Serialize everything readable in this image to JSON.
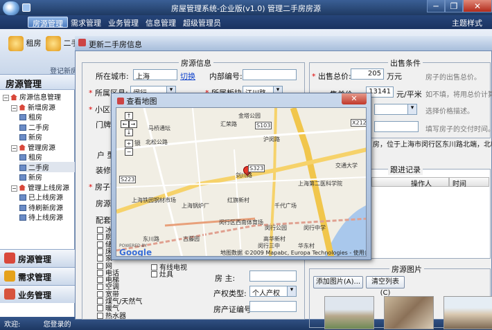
{
  "window": {
    "title": "房屋管理系统-企业版(v1.0) 管理二手房房源",
    "minimize": "─",
    "restore": "❐",
    "close": "✕"
  },
  "menu": {
    "items": [
      "房源管理",
      "需求管理",
      "业务管理",
      "信息管理",
      "超级管理员"
    ],
    "theme": "主题样式 ▾"
  },
  "ribbon": {
    "buttons": [
      "租房",
      "二手"
    ],
    "group_label": "登记新房"
  },
  "sidebar": {
    "title": "房源管理",
    "tree": [
      {
        "label": "房源信息管理",
        "level": 0,
        "kind": "house",
        "exp": "−"
      },
      {
        "label": "新增房源",
        "level": 1,
        "kind": "house",
        "exp": "−"
      },
      {
        "label": "租房",
        "level": 2,
        "kind": "doc"
      },
      {
        "label": "二手房",
        "level": 2,
        "kind": "doc"
      },
      {
        "label": "新房",
        "level": 2,
        "kind": "doc"
      },
      {
        "label": "管理房源",
        "level": 1,
        "kind": "house",
        "exp": "−"
      },
      {
        "label": "租房",
        "level": 2,
        "kind": "doc"
      },
      {
        "label": "二手房",
        "level": 2,
        "kind": "doc",
        "selected": true
      },
      {
        "label": "新房",
        "level": 2,
        "kind": "doc"
      },
      {
        "label": "管理上线房源",
        "level": 1,
        "kind": "house",
        "exp": "−"
      },
      {
        "label": "已上线房源",
        "level": 2,
        "kind": "doc"
      },
      {
        "label": "待刷新房源",
        "level": 2,
        "kind": "doc"
      },
      {
        "label": "待上线房源",
        "level": 2,
        "kind": "doc"
      }
    ],
    "nav": [
      "房源管理",
      "需求管理",
      "业务管理"
    ]
  },
  "status": {
    "welcome": "欢迎:",
    "logged": "您登录的"
  },
  "dialog": {
    "title": "更新二手房信息",
    "house_group": "房源信息",
    "city_label": "所在城市:",
    "city_value": "上海",
    "switch_link": "切换",
    "internal_no_label": "内部编号:",
    "district_label": "所属区县:",
    "district_value": "闵行",
    "block_label": "所属板块:",
    "block_value": "江川路",
    "community_label": "小区名",
    "door_label": "门牌号",
    "type_label": "户 型",
    "decor_label": "装修程",
    "area_label": "房子面",
    "source_label": "房源来",
    "config_label": "配套设",
    "facilities_col1": [
      "冰",
      "厨",
      "储",
      "床",
      "家",
      "网",
      "电话",
      "电梯",
      "空调",
      "宽带",
      "煤气/天然气",
      "暖气",
      "热水器"
    ],
    "facilities_col2": [
      "有线电视",
      "灶具"
    ],
    "owner_label": "房 主:",
    "deed_type_label": "产权类型:",
    "deed_type_value": "个人产权",
    "deed_no_label": "房产证编号:",
    "sale_group": "出售条件",
    "total_price_label": "出售总价:",
    "total_price_value": "205",
    "total_unit": "万元",
    "total_hint": "房子的出售总价。",
    "unit_price_label": "售单价",
    "unit_price_value": "13141",
    "unit_unit": "元/平米",
    "unit_hint": "如不填，将用总价计算。",
    "price_desc_hint": "选择价格描述。",
    "delivery_hint": "填写房子的交付时间。",
    "address_text": "房，位于上海市闵行区东川路北端，北临剑",
    "follow_group": "跟进记录",
    "follow_cols": [
      "操作人",
      "时间"
    ],
    "photo_group": "房源图片",
    "add_photo": "添加图片(A)...",
    "clear_list": "清空列表(C)"
  },
  "map": {
    "title": "查看地图",
    "close": "✕",
    "labels": [
      "金塔公园",
      "马桥通坛",
      "北松公路",
      "S103",
      "X212",
      "交通大学",
      "S323",
      "S223",
      "上海第二医科学院",
      "上海铁园钢材市场",
      "上海锅炉厂",
      "红旗新村",
      "千代广场",
      "闵行公园",
      "闵行中学",
      "闵行区西南体育场",
      "古藤园",
      "东川路",
      "高华新村",
      "闵行三中",
      "华东村",
      "剑川路",
      "汇荣路",
      "沪闵路"
    ],
    "copyright": "地图数据 ©2009 Mapabc, Europa Technologies - 使用条",
    "powered": "POWERED BY",
    "google": "Google",
    "controls": [
      "↑",
      "←",
      "→",
      "↓",
      "+",
      "−"
    ],
    "pan_label": "锁"
  },
  "colors": {
    "accent": "#2c5a95",
    "required": "#dd0000",
    "map_road_yellow": "#f6d26a",
    "map_road_red": "#e0a090"
  }
}
